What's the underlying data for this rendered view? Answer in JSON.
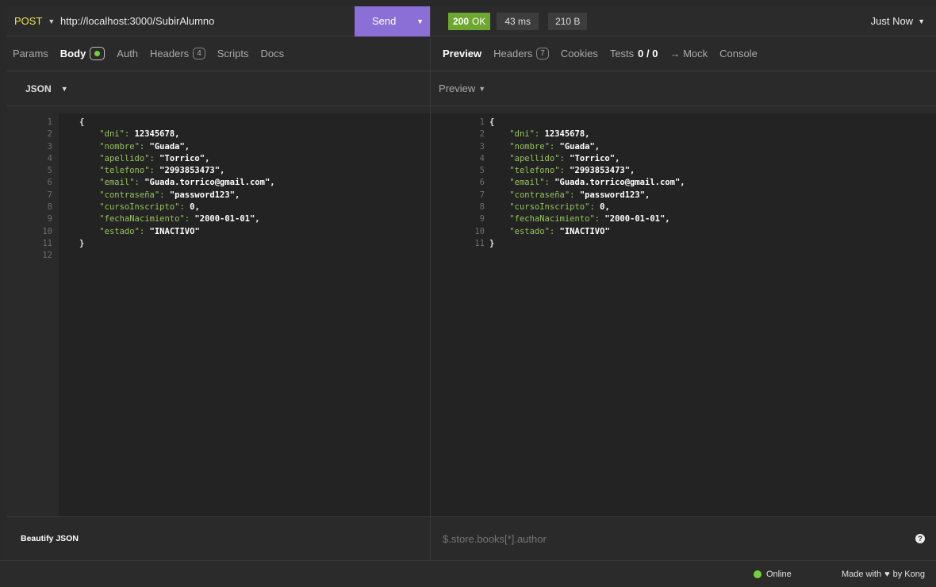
{
  "request": {
    "method": "POST",
    "url": "http://localhost:3000/SubirAlumno",
    "send_label": "Send",
    "tabs": [
      {
        "label": "Params"
      },
      {
        "label": "Body"
      },
      {
        "label": "Auth"
      },
      {
        "label": "Headers",
        "count": "4"
      },
      {
        "label": "Scripts"
      },
      {
        "label": "Docs"
      }
    ],
    "body_type": "JSON",
    "line_numbers": [
      "1",
      "2",
      "3",
      "4",
      "5",
      "6",
      "7",
      "8",
      "9",
      "10",
      "11",
      "12"
    ],
    "beautify_label": "Beautify JSON"
  },
  "response": {
    "status": "200",
    "status_text": "OK",
    "time": "43 ms",
    "size": "210 B",
    "history_label": "Just Now",
    "tabs": [
      {
        "label": "Preview"
      },
      {
        "label": "Headers",
        "count": "7"
      },
      {
        "label": "Cookies"
      },
      {
        "label": "Tests",
        "count": "0 / 0"
      },
      {
        "label": "→ Mock"
      },
      {
        "label": "Console"
      }
    ],
    "preview_label": "Preview",
    "line_numbers": [
      "1",
      "2",
      "3",
      "4",
      "5",
      "6",
      "7",
      "8",
      "9",
      "10",
      "11"
    ],
    "filter_placeholder": "$.store.books[*].author"
  },
  "json_fields": [
    {
      "key": "dni",
      "value": "12345678",
      "type": "number"
    },
    {
      "key": "nombre",
      "value": "Guada",
      "type": "string"
    },
    {
      "key": "apellido",
      "value": "Torrico",
      "type": "string"
    },
    {
      "key": "telefono",
      "value": "2993853473",
      "type": "string"
    },
    {
      "key": "email",
      "value": "Guada.torrico@gmail.com",
      "type": "string"
    },
    {
      "key": "contraseña",
      "value": "password123",
      "type": "string"
    },
    {
      "key": "cursoInscripto",
      "value": "0",
      "type": "number"
    },
    {
      "key": "fechaNacimiento",
      "value": "2000-01-01",
      "type": "string"
    },
    {
      "key": "estado",
      "value": "INACTIVO",
      "type": "string"
    }
  ],
  "footer": {
    "online_label": "Online",
    "made_with_prefix": "Made with",
    "made_with_suffix": "by Kong"
  },
  "colors": {
    "send_button": "#8b6fd6",
    "status_ok": "#6da72f",
    "online_dot": "#73d13d",
    "json_key": "#98c45a"
  }
}
